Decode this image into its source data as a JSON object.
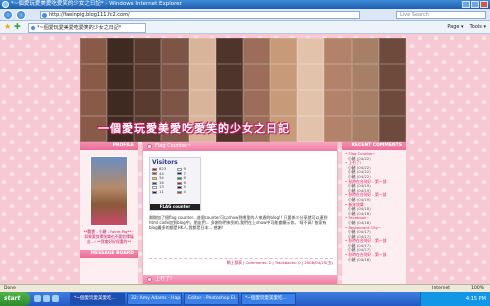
{
  "window": {
    "title": "*~個愛玩愛美愛吃愛笑的少女之日記* - Windows Internet Explorer"
  },
  "toolbar": {
    "url": "http://faeinpig.blog111.fc2.com/",
    "search_placeholder": "Live Search"
  },
  "favorites": {
    "tab_label": "*~個愛玩愛美愛吃愛笑的少女之日記*",
    "tools": [
      "Page ▾",
      "Tools ▾"
    ]
  },
  "blog": {
    "header_title": "一個愛玩愛美愛吃愛笑的少女之日記",
    "profile_head": "PROFILE",
    "profile_caption": "**飄雲 - 小豬 - Fairie-Pig**~\n如果要剪擇快樂也不要剪擇痛苦...! \n**我會好好保重的**",
    "message_head": "MESSAGE BOARD",
    "post_title": "Flag Counter~",
    "post_body": "剛剛加了個flag counter...這個counter可以show到哪里的人來過的blog!! 只要係少分享就可以連到html code加到blog中。朋友們...\n多謝你們來到的,我們在上show中可能會顯示你。\n呀不高!\n\n依家有blog最多的都是HK人,我都是日本... 感謝!",
    "post_meta": "網上發表 | Comments: 2 | Trackbacks: 0 | 2008/04/25(五)",
    "next_post_title": "上冇了!",
    "recent_head": "RECENT COMMENTS",
    "comments": [
      {
        "t": "Flag Counter~",
        "w": "小豬 (04/22)"
      },
      {
        "t": "上冇了!",
        "w": "小豬 (04/22)"
      },
      {
        "t": "",
        "w": "小豬 (04/22)"
      },
      {
        "t": "",
        "w": "小豬 (04/22)"
      },
      {
        "t": "秋時在台灣好 - 第一部",
        "w": "小豬 (04/19)"
      },
      {
        "t": "",
        "w": "小豬 (04/19)"
      },
      {
        "t": "秋時在台灣好 - 第一部",
        "w": "小豬 (04/19)"
      },
      {
        "t": "新年快樂",
        "w": "小豬 (04/18)"
      },
      {
        "t": "",
        "w": "小豬 (04/18)"
      },
      {
        "t": "Facebook~",
        "w": "小豬 (04/18)"
      },
      {
        "t": "Restaurant City~",
        "w": "小豬 (04/17)"
      },
      {
        "t": "",
        "w": "小豬 (04/17)"
      },
      {
        "t": "秋時在台灣好 - 第一部",
        "w": "小豬 (04/17)"
      },
      {
        "t": "",
        "w": "小豬 (04/17)"
      },
      {
        "t": "秋時在台灣好 - 第一部",
        "w": "小豬 (04/16)"
      }
    ],
    "visitors": {
      "title": "Visitors",
      "rows": [
        {
          "v": "823",
          "c": "#c8102e"
        },
        {
          "v": "9",
          "c": "#ffffff"
        },
        {
          "v": "44",
          "c": "#d52b1e"
        },
        {
          "v": "7",
          "c": "#003087"
        },
        {
          "v": "34",
          "c": "#ffcc00"
        },
        {
          "v": "6",
          "c": "#009b3a"
        },
        {
          "v": "16",
          "c": "#0055a4"
        },
        {
          "v": "6",
          "c": "#ce1126"
        },
        {
          "v": "13",
          "c": "#ffffff"
        },
        {
          "v": "5",
          "c": "#012169"
        },
        {
          "v": "11",
          "c": "#00247d"
        },
        {
          "v": "4",
          "c": "#d52b1e"
        }
      ],
      "footer": "FLAG counter"
    }
  },
  "statusbar": {
    "text": "Done",
    "zone": "Internet",
    "zoom": "100%"
  },
  "taskbar": {
    "start": "start",
    "tasks": [
      {
        "label": "*~個愛玩愛美愛吃...",
        "active": true
      },
      {
        "label": "32: Amy Adams - Hap...",
        "active": false
      },
      {
        "label": "Editor - Photoshop El...",
        "active": false
      },
      {
        "label": "*~個愛玩愛美愛吃...",
        "active": false
      }
    ],
    "clock": "4:15 PM"
  }
}
